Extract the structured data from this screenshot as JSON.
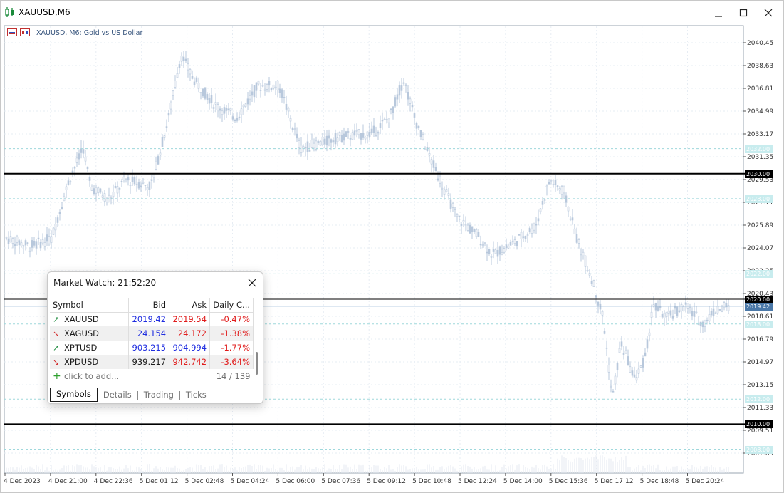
{
  "window": {
    "title": "XAUUSD,M6"
  },
  "chart": {
    "label": "XAUUSD, M6:  Gold vs US Dollar",
    "candle_color": "#b8c8dc",
    "background": "#ffffff",
    "grid_color": "#e6ecf3",
    "price_axis": [
      "2040.45",
      "2038.63",
      "2036.81",
      "2034.99",
      "2033.17",
      "2031.35",
      "2029.53",
      "2027.71",
      "2025.89",
      "2024.07",
      "2022.25",
      "2020.43",
      "2018.61",
      "2016.79",
      "2014.97",
      "2013.15",
      "2011.33",
      "2009.51",
      "2007.69"
    ],
    "time_axis": [
      "4 Dec 2023",
      "4 Dec 21:00",
      "4 Dec 22:36",
      "5 Dec 01:12",
      "5 Dec 02:48",
      "5 Dec 04:24",
      "5 Dec 06:00",
      "5 Dec 07:36",
      "5 Dec 09:12",
      "5 Dec 10:48",
      "5 Dec 12:24",
      "5 Dec 14:00",
      "5 Dec 15:36",
      "5 Dec 17:12",
      "5 Dec 18:48",
      "5 Dec 20:24"
    ],
    "solid_levels": [
      "2030.00",
      "2020.00",
      "2010.00"
    ],
    "dashed_levels": [
      "2032.00",
      "2028.00",
      "2022.00",
      "2018.00",
      "2012.00",
      "2008.00"
    ],
    "current_price": "2019.42"
  },
  "market_watch": {
    "title": "Market Watch: 21:52:20",
    "columns": {
      "symbol": "Symbol",
      "bid": "Bid",
      "ask": "Ask",
      "change": "Daily C..."
    },
    "rows": [
      {
        "symbol": "XAUUSD",
        "dir": "up",
        "bid": "2019.42",
        "ask": "2019.54",
        "change": "-0.47%",
        "bid_color": "blue",
        "ask_color": "red"
      },
      {
        "symbol": "XAGUSD",
        "dir": "down",
        "bid": "24.154",
        "ask": "24.172",
        "change": "-1.38%",
        "bid_color": "blue",
        "ask_color": "red"
      },
      {
        "symbol": "XPTUSD",
        "dir": "up",
        "bid": "903.215",
        "ask": "904.994",
        "change": "-1.77%",
        "bid_color": "blue",
        "ask_color": "blue"
      },
      {
        "symbol": "XPDUSD",
        "dir": "down",
        "bid": "939.217",
        "ask": "942.742",
        "change": "-3.64%",
        "bid_color": "dark",
        "ask_color": "red"
      }
    ],
    "add_label": "click to add...",
    "count": "14 / 139",
    "tabs": [
      "Symbols",
      "Details",
      "Trading",
      "Ticks"
    ]
  }
}
